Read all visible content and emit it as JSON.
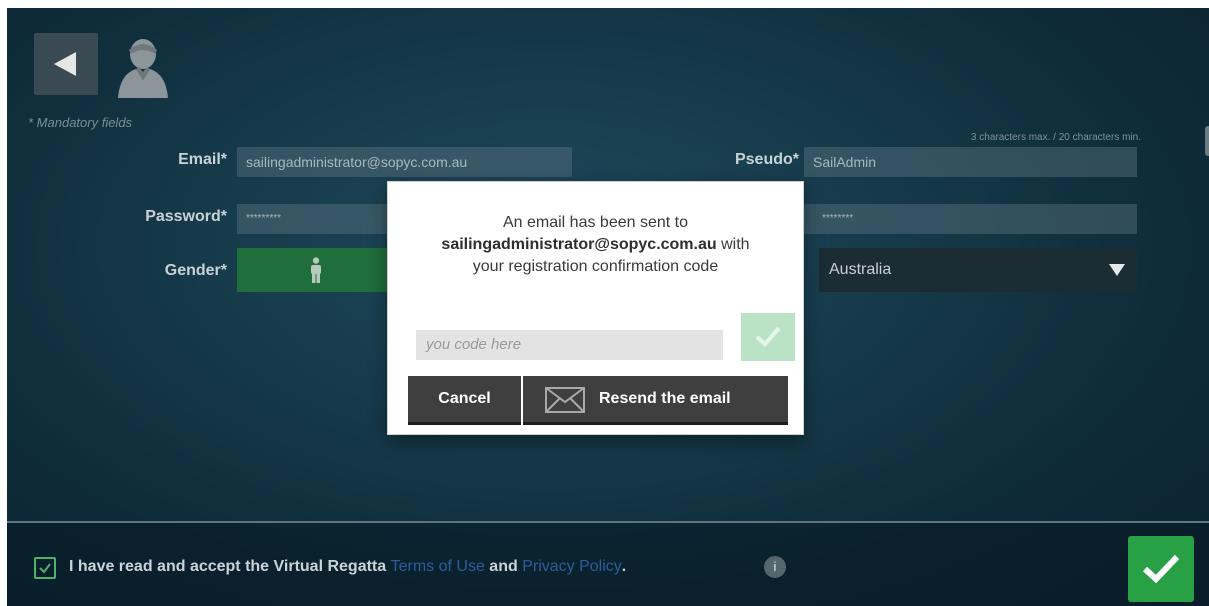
{
  "form": {
    "mandatory_note": "* Mandatory fields",
    "email_label": "Email*",
    "email_value": "sailingadministrator@sopyc.com.au",
    "pseudo_label": "Pseudo*",
    "pseudo_value": "SailAdmin",
    "pseudo_hint": "3 characters max. / 20 characters min.",
    "password_label": "Password*",
    "password_value": "*********",
    "password_confirm_value": "********",
    "gender_label": "Gender*",
    "gender_selected_icon": "male-person-icon",
    "country_value": "Australia"
  },
  "footer": {
    "terms_prefix": "I have read and accept the Virtual Regatta ",
    "terms_link": "Terms of Use",
    "terms_and": " and ",
    "privacy_link": "Privacy Policy",
    "terms_suffix": ".",
    "info_icon": "i",
    "checked": true
  },
  "modal": {
    "line1": "An email has been sent to",
    "email": "sailingadministrator@sopyc.com.au",
    "line2_suffix": " with",
    "line3": "your registration confirmation code",
    "code_placeholder": "you code here",
    "cancel_label": "Cancel",
    "resend_label": "Resend the email"
  },
  "colors": {
    "accent_green": "#28a045",
    "link_blue": "#2d5d9e",
    "background": "#163b4b"
  }
}
